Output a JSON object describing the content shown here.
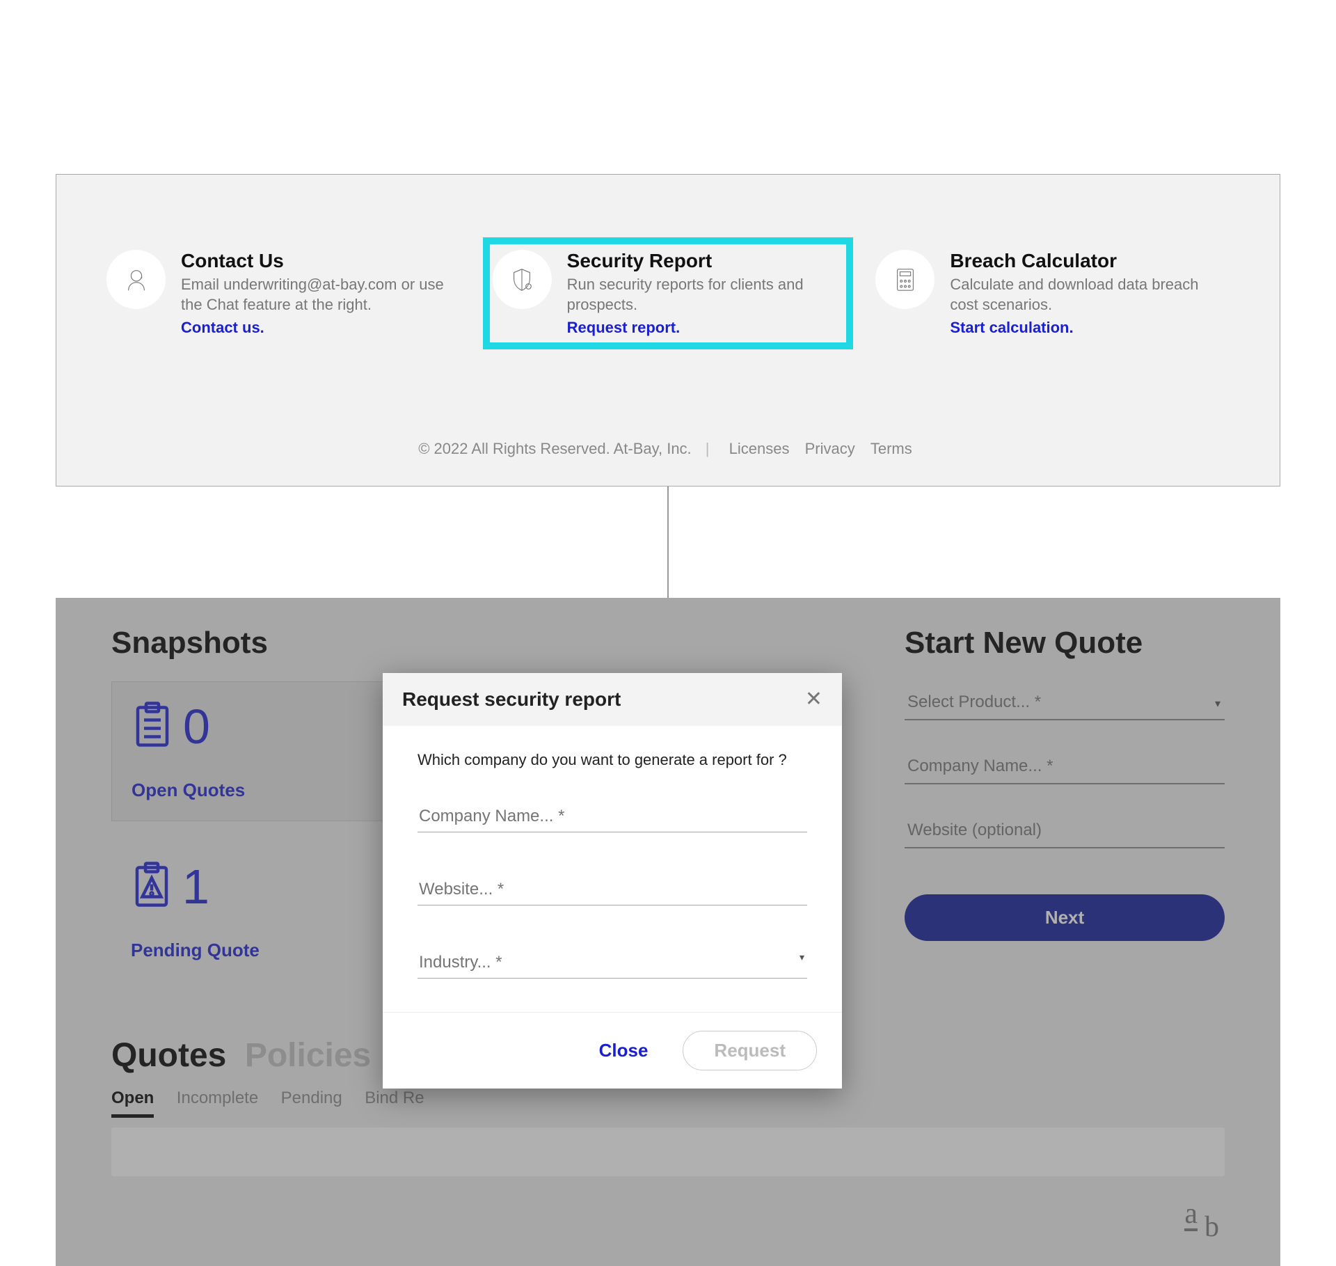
{
  "cards": {
    "contact": {
      "title": "Contact Us",
      "desc": "Email underwriting@at-bay.com or use the Chat feature at the right.",
      "link": "Contact us."
    },
    "security": {
      "title": "Security Report",
      "desc": "Run security reports for clients and prospects.",
      "link": "Request report."
    },
    "breach": {
      "title": "Breach Calculator",
      "desc": "Calculate and download data breach cost scenarios.",
      "link": "Start calculation."
    }
  },
  "footer": {
    "copyright": "© 2022 All Rights Reserved. At-Bay, Inc.",
    "links": [
      "Licenses",
      "Privacy",
      "Terms"
    ]
  },
  "bg": {
    "snapshots_title": "Snapshots",
    "open_quotes": {
      "count": "0",
      "label": "Open Quotes"
    },
    "pending_quote": {
      "count": "1",
      "label": "Pending Quote"
    },
    "new_quote_title": "Start New Quote",
    "nq_select_product": "Select Product... *",
    "nq_company": "Company Name... *",
    "nq_website": "Website (optional)",
    "next": "Next",
    "tabs_major": [
      "Quotes",
      "Policies"
    ],
    "tabs_minor": [
      "Open",
      "Incomplete",
      "Pending",
      "Bind Re"
    ]
  },
  "modal": {
    "title": "Request security report",
    "question": "Which company do you want to generate a report for ?",
    "company_ph": "Company Name... *",
    "website_ph": "Website... *",
    "industry_ph": "Industry... *",
    "close": "Close",
    "request": "Request"
  },
  "mark": {
    "a": "a",
    "b": "b"
  }
}
